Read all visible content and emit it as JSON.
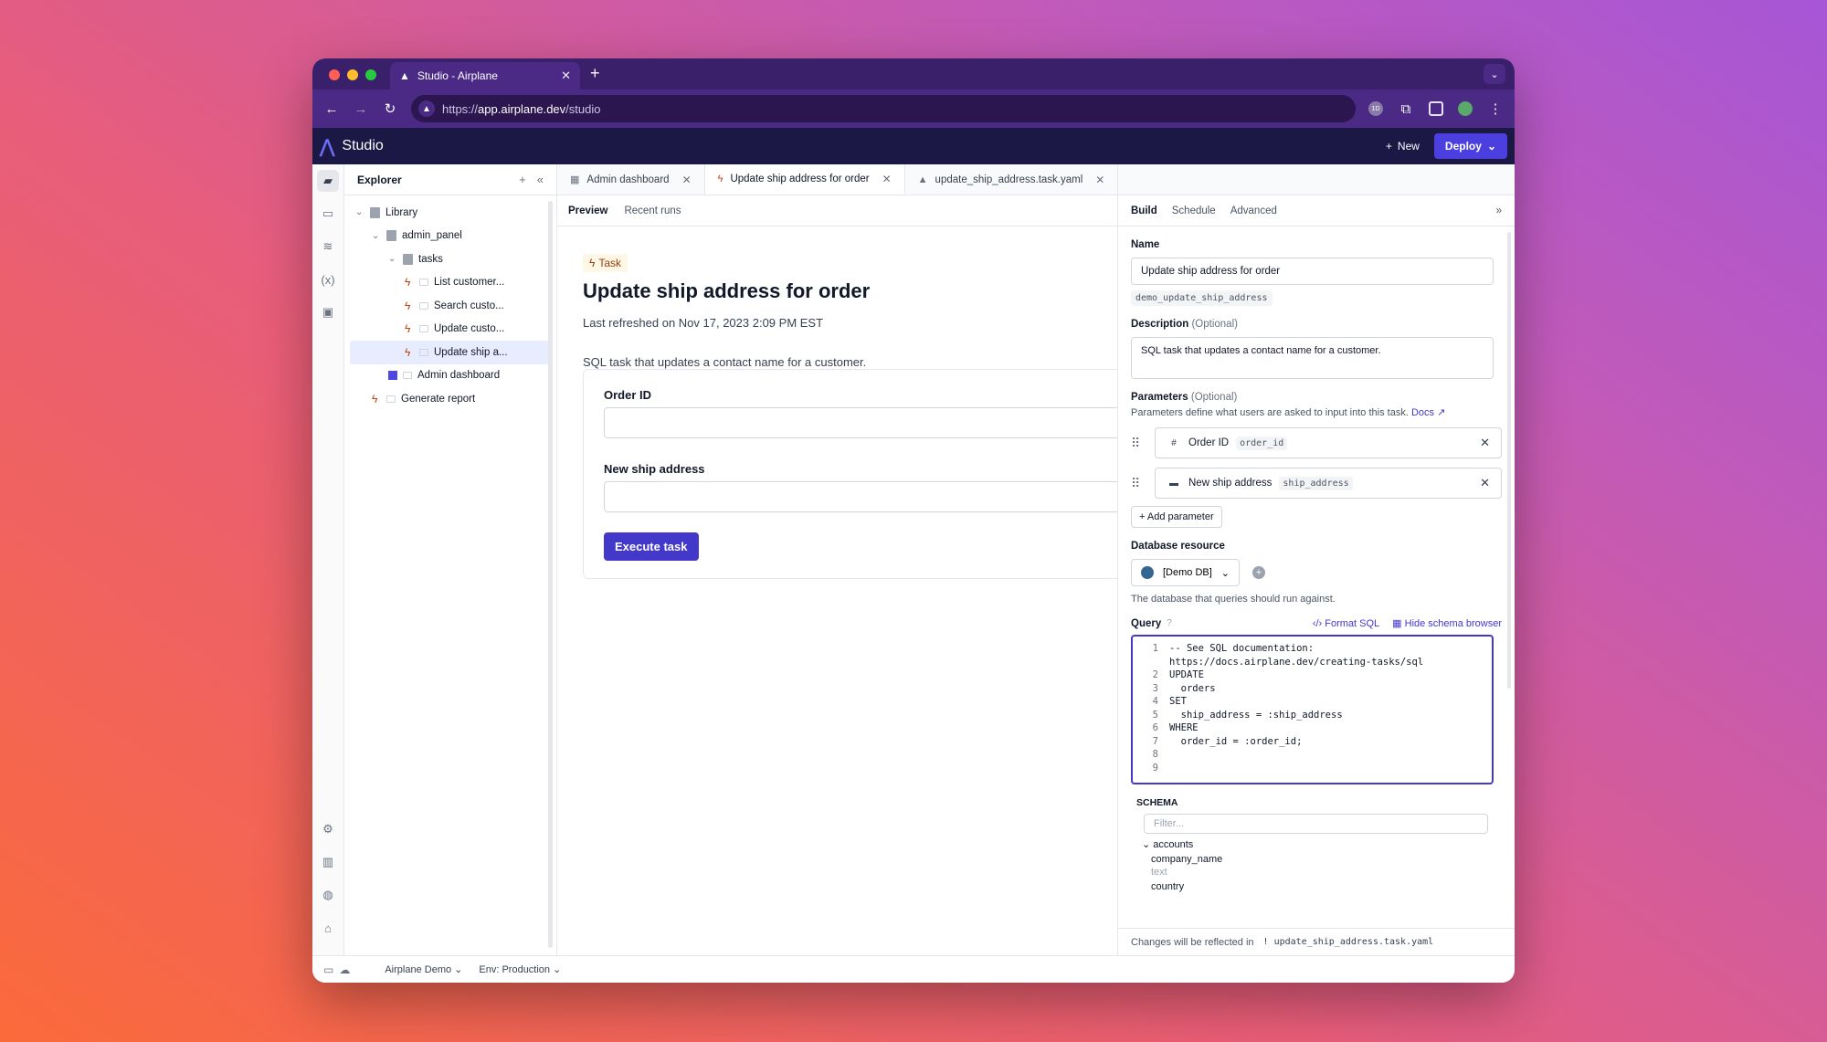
{
  "browser": {
    "tab_title": "Studio - Airplane",
    "url_prefix": "https://",
    "url_host": "app.airplane.dev",
    "url_path": "/studio"
  },
  "app": {
    "title": "Studio",
    "new_label": "New",
    "deploy_label": "Deploy"
  },
  "explorer": {
    "title": "Explorer",
    "items": [
      {
        "label": "Library"
      },
      {
        "label": "admin_panel"
      },
      {
        "label": "tasks"
      },
      {
        "label": "List customer..."
      },
      {
        "label": "Search custo..."
      },
      {
        "label": "Update custo..."
      },
      {
        "label": "Update ship a..."
      },
      {
        "label": "Admin dashboard"
      },
      {
        "label": "Generate report"
      }
    ]
  },
  "file_tabs": [
    {
      "label": "Admin dashboard"
    },
    {
      "label": "Update ship address for order"
    },
    {
      "label": "update_ship_address.task.yaml"
    }
  ],
  "preview": {
    "tabs": [
      "Preview",
      "Recent runs"
    ],
    "badge": "Task",
    "title": "Update ship address for order",
    "refreshed": "Last refreshed on Nov 17, 2023 2:09 PM EST",
    "description": "SQL task that updates a contact name for a customer.",
    "fields": [
      {
        "label": "Order ID"
      },
      {
        "label": "New ship address"
      }
    ],
    "execute_label": "Execute task"
  },
  "build": {
    "tabs": [
      "Build",
      "Schedule",
      "Advanced"
    ],
    "name_label": "Name",
    "name_value": "Update ship address for order",
    "slug": "demo_update_ship_address",
    "description_label": "Description",
    "optional": "(Optional)",
    "description_value": "SQL task that updates a contact name for a customer.",
    "parameters_label": "Parameters",
    "parameters_help": "Parameters define what users are asked to input into this task.",
    "docs_label": "Docs",
    "params": [
      {
        "name": "Order ID",
        "slug": "order_id",
        "type_glyph": "#"
      },
      {
        "name": "New ship address",
        "slug": "ship_address",
        "type_glyph": "▬"
      }
    ],
    "add_parameter": "Add parameter",
    "db_label": "Database resource",
    "db_value": "[Demo DB]",
    "db_help": "The database that queries should run against.",
    "query_label": "Query",
    "format_sql": "Format SQL",
    "hide_schema": "Hide schema browser",
    "query_lines": [
      {
        "n": "1",
        "text": "-- See SQL documentation:",
        "cls": "cm"
      },
      {
        "n": "",
        "text": "https://docs.airplane.dev/creating-tasks/sql",
        "cls": "cm"
      },
      {
        "n": "2",
        "text": "UPDATE",
        "cls": "kw"
      },
      {
        "n": "3",
        "text": "  orders",
        "cls": ""
      },
      {
        "n": "4",
        "text": "SET",
        "cls": "kw"
      },
      {
        "n": "5",
        "text": "  ship_address = :ship_address",
        "cls": ""
      },
      {
        "n": "6",
        "text": "WHERE",
        "cls": "kw"
      },
      {
        "n": "7",
        "text": "  order_id = :order_id;",
        "cls": ""
      },
      {
        "n": "8",
        "text": "",
        "cls": ""
      },
      {
        "n": "9",
        "text": "",
        "cls": ""
      }
    ],
    "schema_label": "SCHEMA",
    "filter_placeholder": "Filter...",
    "schema_table": "accounts",
    "schema_columns": [
      {
        "name": "company_name",
        "type": "text"
      },
      {
        "name": "country",
        "type": ""
      }
    ],
    "footer_text": "Changes will be reflected in",
    "footer_file": "update_ship_address.task.yaml"
  },
  "statusbar": {
    "team": "Airplane Demo",
    "env": "Env: Production"
  }
}
